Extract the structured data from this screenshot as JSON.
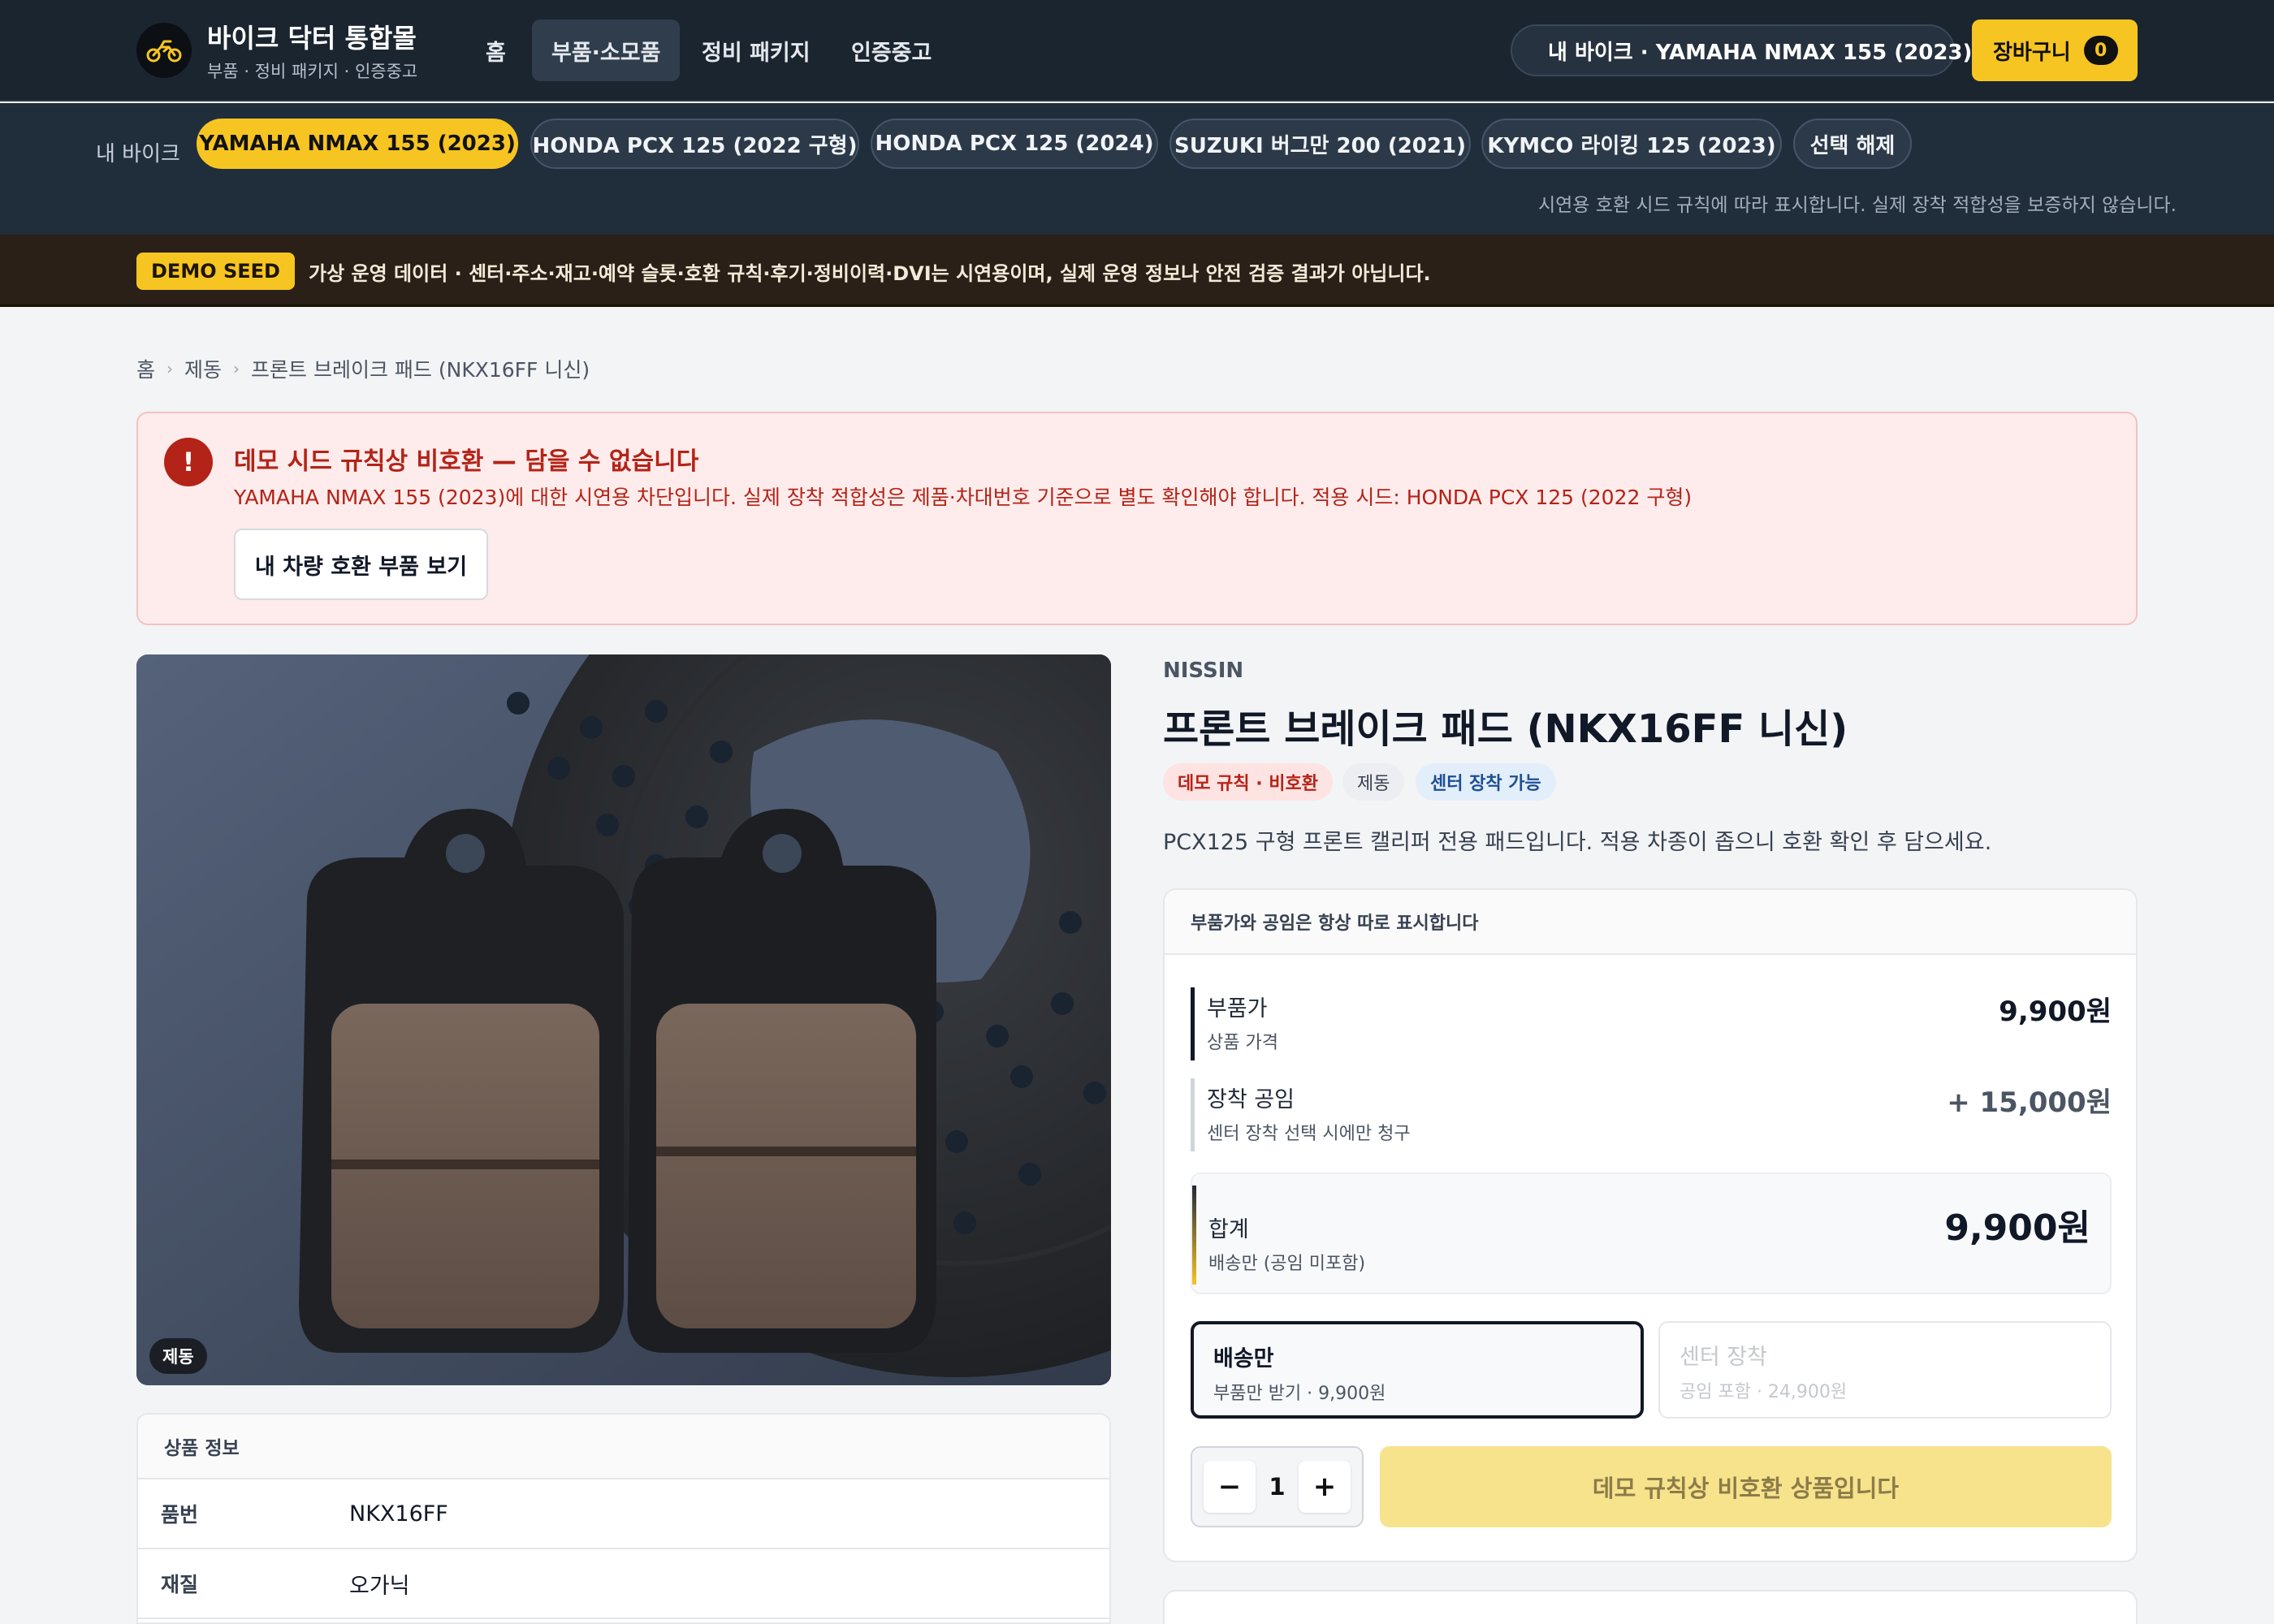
{
  "header": {
    "brand_title": "바이크 닥터 통합몰",
    "brand_sub": "부품 · 정비 패키지 · 인증중고",
    "nav": [
      "홈",
      "부품·소모품",
      "정비 패키지",
      "인증중고"
    ],
    "my_bike_pill": "내 바이크 · YAMAHA NMAX 155 (2023)",
    "cart_label": "장바구니",
    "cart_count": "0",
    "accent": "#f7c521"
  },
  "bikebar": {
    "label": "내 바이크",
    "chips": [
      "YAMAHA NMAX 155 (2023)",
      "HONDA PCX 125 (2022 구형)",
      "HONDA PCX 125 (2024)",
      "SUZUKI 버그만 200 (2021)",
      "KYMCO 라이킹 125 (2023)",
      "선택 해제"
    ],
    "selected_index": 0,
    "note": "시연용 호환 시드 규칙에 따라 표시합니다. 실제 장착 적합성을 보증하지 않습니다."
  },
  "seed": {
    "badge": "DEMO SEED",
    "text": "가상 운영 데이터 · 센터·주소·재고·예약 슬롯·호환 규칙·후기·정비이력·DVI는 시연용이며, 실제 운영 정보나 안전 검증 결과가 아닙니다."
  },
  "breadcrumb": [
    "홈",
    "제동",
    "프론트 브레이크 패드 (NKX16FF 니신)"
  ],
  "alert": {
    "icon": "!",
    "title": "데모 시드 규칙상 비호환 — 담을 수 없습니다",
    "desc": "YAMAHA NMAX 155 (2023)에 대한 시연용 차단입니다. 실제 장착 적합성은 제품·차대번호 기준으로 별도 확인해야 합니다. 적용 시드: HONDA PCX 125 (2022 구형)",
    "button": "내 차량 호환 부품 보기",
    "color": "#b42318"
  },
  "product": {
    "image_tag": "제동",
    "brand": "NISSIN",
    "title": "프론트 브레이크 패드 (NKX16FF 니신)",
    "badges": [
      "데모 규칙 · 비호환",
      "제동",
      "센터 장착 가능"
    ],
    "desc": "PCX125 구형 프론트 캘리퍼 전용 패드입니다. 적용 차종이 좁으니 호환 확인 후 담으세요."
  },
  "spec": {
    "title": "상품 정보",
    "rows": [
      {
        "k": "품번",
        "v": "NKX16FF"
      },
      {
        "k": "재질",
        "v": "오가닉"
      }
    ]
  },
  "price": {
    "head": "부품가와 공임은 항상 따로 표시합니다",
    "part_label": "부품가",
    "part_sub": "상품 가격",
    "part_value": "9,900원",
    "labor_label": "장착 공임",
    "labor_sub": "센터 장착 선택 시에만 청구",
    "labor_value": "+ 15,000원",
    "total_label": "합계",
    "total_sub": "배송만 (공임 미포함)",
    "total_value": "9,900원",
    "options": [
      {
        "title": "배송만",
        "sub": "부품만 받기 · 9,900원",
        "selected": true
      },
      {
        "title": "센터 장착",
        "sub": "공임 포함 · 24,900원",
        "selected": false
      }
    ],
    "qty": "1",
    "qty_minus": "−",
    "qty_plus": "+",
    "cta": "데모 규칙상 비호환 상품입니다"
  }
}
